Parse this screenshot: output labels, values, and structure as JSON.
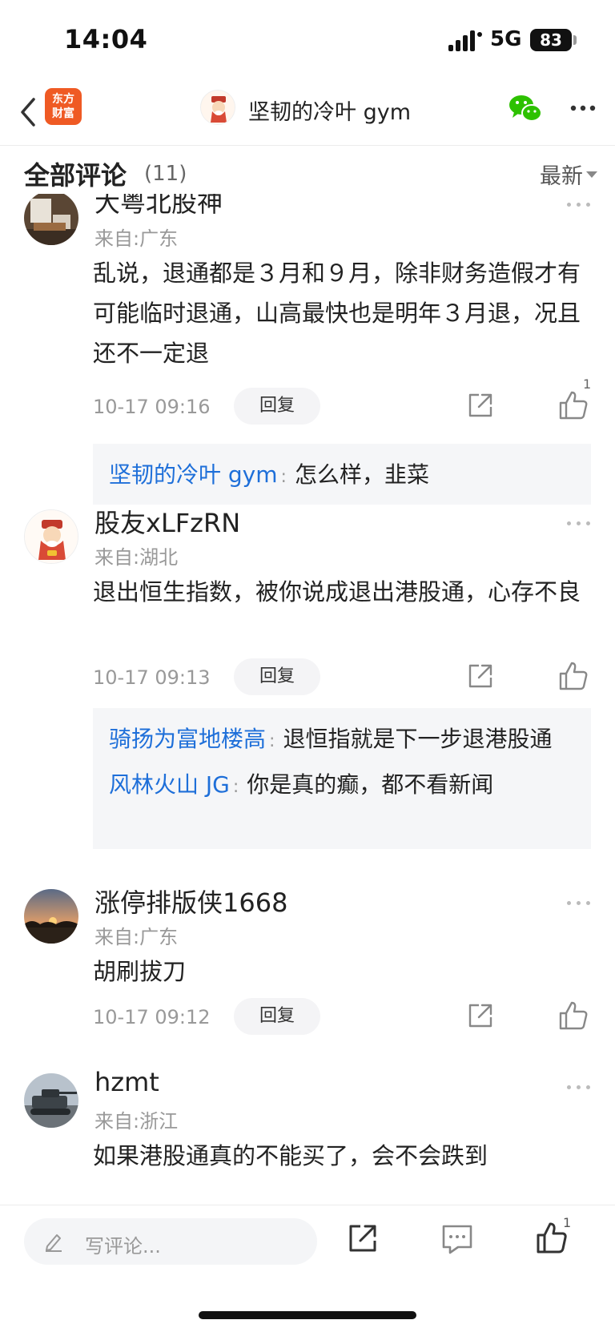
{
  "status_bar": {
    "time": "14:04",
    "network": "5G",
    "battery": "83"
  },
  "nav": {
    "app_logo_text": "东方\n财富",
    "title": "坚韧的冷叶 gym"
  },
  "comments_header": {
    "title": "全部评论",
    "count": "(11)",
    "sort": "最新"
  },
  "comments": [
    {
      "name": "大粤北股神",
      "location": "来自:广东",
      "text": "乱说，退通都是３月和９月，除非财务造假才有可能临时退通，山高最快也是明年３月退，况且还不一定退",
      "time": "10-17 09:16",
      "reply_label": "回复",
      "like_count": "1",
      "replies": [
        {
          "user": "坚韧的冷叶 gym",
          "text": "怎么样，韭菜"
        }
      ]
    },
    {
      "name": "股友xLFzRN",
      "location": "来自:湖北",
      "text": "退出恒生指数，被你说成退出港股通，心存不良",
      "time": "10-17 09:13",
      "reply_label": "回复",
      "like_count": "",
      "replies": [
        {
          "user": "骑扬为富地楼高",
          "text": "退恒指就是下一步退港股通"
        },
        {
          "user": "风林火山 JG",
          "text": "你是真的癫，都不看新闻"
        }
      ]
    },
    {
      "name": "涨停排版侠1668",
      "location": "来自:广东",
      "text": "胡刷拔刀",
      "time": "10-17 09:12",
      "reply_label": "回复",
      "like_count": "",
      "replies": []
    },
    {
      "name": "hzmt",
      "location": "来自:浙江",
      "text": "如果港股通真的不能买了，会不会跌到",
      "time": "",
      "reply_label": "",
      "like_count": "",
      "replies": []
    }
  ],
  "bottom_bar": {
    "compose_placeholder": "写评论...",
    "like_count": "1"
  },
  "colors": {
    "accent_blue": "#1e6fd9",
    "brand_orange": "#ef5a24",
    "wechat_green": "#2dc100"
  }
}
